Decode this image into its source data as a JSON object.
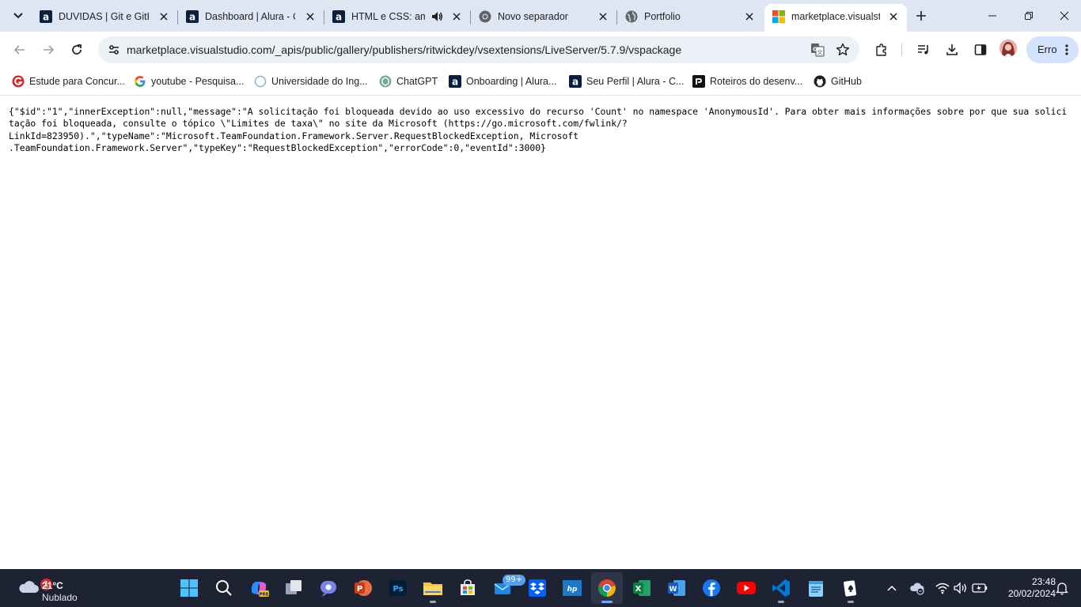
{
  "tabs": [
    {
      "title": "DUVIDAS | Git e GitHub",
      "icon": "alura-icon",
      "close": "×"
    },
    {
      "title": "Dashboard | Alura - Cursos",
      "icon": "alura-icon",
      "close": "×"
    },
    {
      "title": "HTML e CSS: ambiente",
      "icon": "alura-icon",
      "audio": true,
      "close": "×"
    },
    {
      "title": "Novo separador",
      "icon": "chrome-icon",
      "close": "×"
    },
    {
      "title": "Portfolio",
      "icon": "globe-icon",
      "close": "×"
    },
    {
      "title": "marketplace.visualstudio.com",
      "icon": "microsoft-icon",
      "active": true,
      "close": "×"
    }
  ],
  "toolbar": {
    "url": "marketplace.visualstudio.com/_apis/public/gallery/publishers/ritwickdey/vsextensions/LiveServer/5.7.9/vspackage",
    "error_label": "Erro"
  },
  "bookmarks": [
    {
      "label": "Estude para Concur...",
      "icon": "red-g-icon"
    },
    {
      "label": "youtube - Pesquisa...",
      "icon": "google-icon"
    },
    {
      "label": "Universidade do Ing...",
      "icon": "circle-icon"
    },
    {
      "label": "ChatGPT",
      "icon": "chatgpt-icon"
    },
    {
      "label": "Onboarding | Alura...",
      "icon": "alura-icon"
    },
    {
      "label": "Seu Perfil | Alura - C...",
      "icon": "alura-icon"
    },
    {
      "label": "Roteiros do desenv...",
      "icon": "roteiros-icon"
    },
    {
      "label": "GitHub",
      "icon": "github-icon"
    }
  ],
  "content": {
    "json_text": "{\"$id\":\"1\",\"innerException\":null,\"message\":\"A solicitação foi bloqueada devido ao uso excessivo do recurso 'Count' no namespace 'AnonymousId'. Para obter mais informações sobre por que sua solicitação foi bloqueada, consulte o tópico \\\"Limites de taxa\\\" no site da Microsoft (https://go.microsoft.com/fwlink/?\nLinkId=823950).\",\"typeName\":\"Microsoft.TeamFoundation.Framework.Server.RequestBlockedException, Microsoft\n.TeamFoundation.Framework.Server\",\"typeKey\":\"RequestBlockedException\",\"errorCode\":0,\"eventId\":3000}"
  },
  "taskbar": {
    "weather_temp": "21°C",
    "weather_desc": "Nublado",
    "weather_badge": "1",
    "mail_badge": "99+",
    "time": "23:48",
    "date": "20/02/2024",
    "apps": [
      "start-icon",
      "search-icon",
      "copilot-icon",
      "task-view-icon",
      "teams-icon",
      "powerpoint-icon",
      "photoshop-icon",
      "file-explorer-icon",
      "store-icon",
      "mail-icon",
      "dropbox-icon",
      "hp-icon",
      "chrome-icon",
      "excel-icon",
      "word-icon",
      "facebook-icon",
      "youtube-icon",
      "vscode-icon",
      "notepad-icon",
      "solitaire-icon"
    ]
  }
}
